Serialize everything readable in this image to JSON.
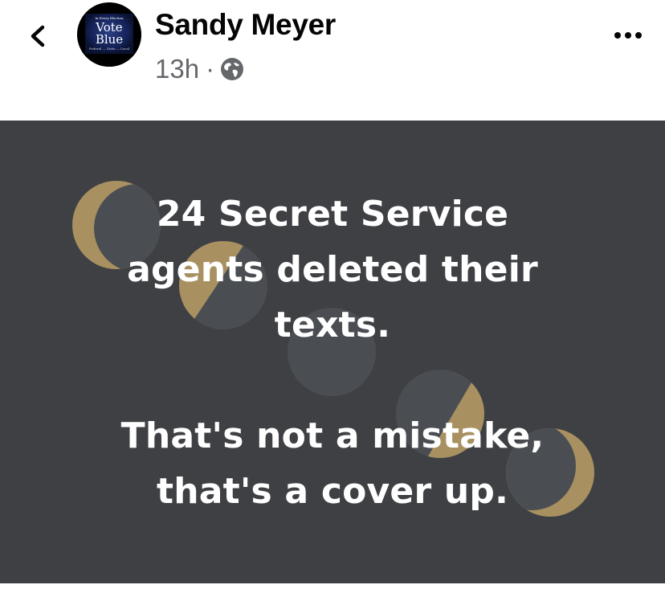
{
  "post": {
    "author": "Sandy Meyer",
    "timestamp": "13h",
    "separator": "·",
    "privacy_icon": "globe-icon",
    "avatar": {
      "top_text": "In Every Election",
      "line1": "Vote",
      "line2": "Blue",
      "bottom_text": "Federal — State — Local"
    }
  },
  "nav": {
    "back_icon": "chevron-left-icon",
    "more_icon": "more-horizontal-icon"
  },
  "image_text": {
    "paragraph1": [
      "24 Secret Service",
      "agents deleted their",
      "texts."
    ],
    "paragraph2": [
      "That's not a mistake,",
      "that's a cover up."
    ]
  },
  "colors": {
    "image_background": "#3e4044",
    "moon_gold": "#a89061",
    "moon_dark": "#4a4e53",
    "text": "#ffffff",
    "timestamp": "#65676b"
  }
}
